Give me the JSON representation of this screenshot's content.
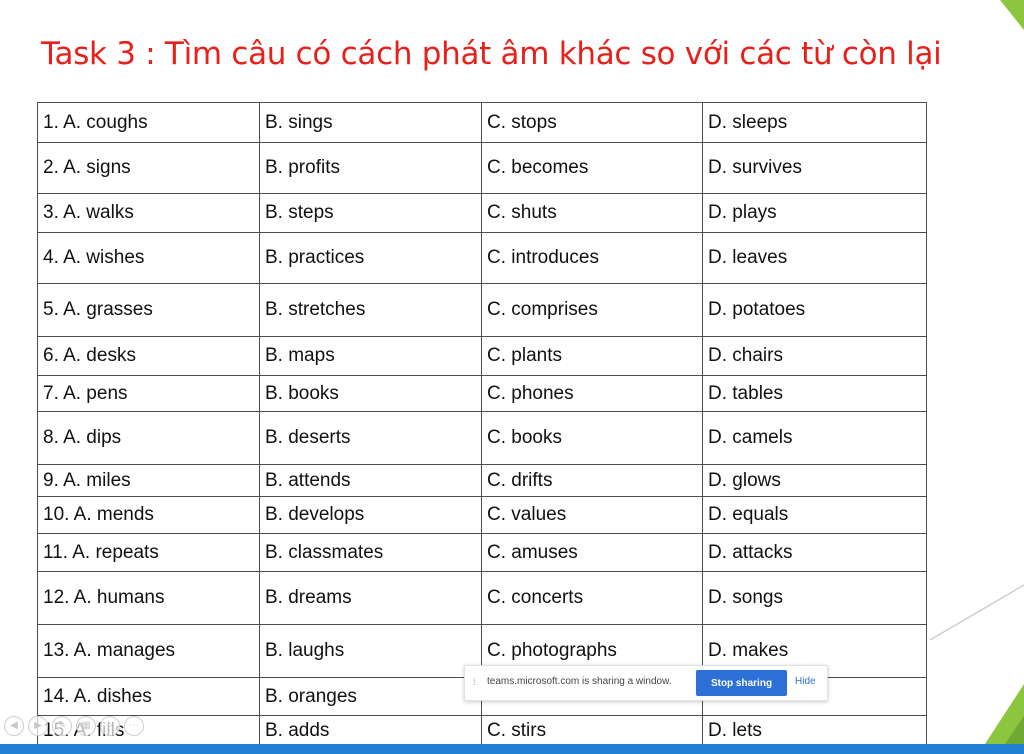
{
  "title": "Task 3 : Tìm câu có cách phát âm khác so với các từ còn lại",
  "rows": [
    {
      "a": "1. A. coughs",
      "b": "B. sings",
      "c": "C. stops",
      "d": "D. sleeps"
    },
    {
      "a": "2. A. signs",
      "b": "B. profits",
      "c": "C. becomes",
      "d": "D. survives"
    },
    {
      "a": "3. A. walks",
      "b": "B. steps",
      "c": "C. shuts",
      "d": "D. plays"
    },
    {
      "a": "4. A. wishes",
      "b": "B. practices",
      "c": "C. introduces",
      "d": "D. leaves"
    },
    {
      "a": "5. A. grasses",
      "b": "B. stretches",
      "c": "C. comprises",
      "d": "D. potatoes"
    },
    {
      "a": "6. A. desks",
      "b": "B. maps",
      "c": "C. plants",
      "d": "D. chairs"
    },
    {
      "a": "7. A. pens",
      "b": "B. books",
      "c": "C. phones",
      "d": "D. tables"
    },
    {
      "a": "8. A. dips",
      "b": "B. deserts",
      "c": "C. books",
      "d": "D. camels"
    },
    {
      "a": "9. A. miles",
      "b": "B. attends",
      "c": "C. drifts",
      "d": "D. glows"
    },
    {
      "a": "10. A. mends",
      "b": "B. develops",
      "c": "C. values",
      "d": "D. equals"
    },
    {
      "a": "11. A. repeats",
      "b": "B. classmates",
      "c": "C. amuses",
      "d": "D. attacks"
    },
    {
      "a": "12. A. humans",
      "b": "B. dreams",
      "c": "C. concerts",
      "d": "D. songs"
    },
    {
      "a": "13. A. manages",
      "b": "B. laughs",
      "c": "C. photographs",
      "d": "D. makes"
    },
    {
      "a": "14. A. dishes",
      "b": "B. oranges",
      "c": "",
      "d": ""
    },
    {
      "a": "15. A. fills",
      "b": "B. adds",
      "c": "C. stirs",
      "d": "D. lets"
    }
  ],
  "share_bar": {
    "message": "teams.microsoft.com is sharing a window.",
    "stop_label": "Stop sharing",
    "hide_label": "Hide",
    "stop_color": "#2c6fd6"
  },
  "colors": {
    "title": "#e8201a",
    "accent_green": "#8cc63f",
    "bottom_strip": "#1f7fd1"
  }
}
